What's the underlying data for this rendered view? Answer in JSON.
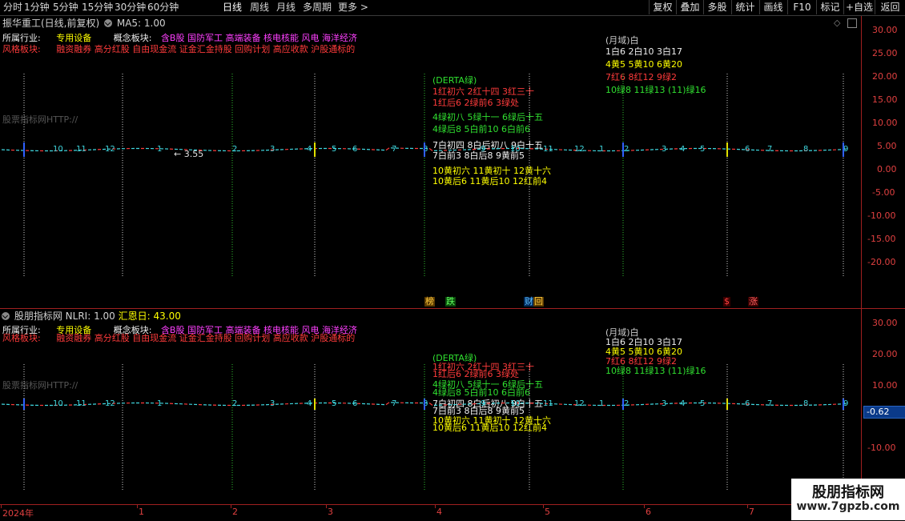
{
  "toolbar": {
    "periods": [
      "分时",
      "1分钟",
      "5分钟",
      "15分钟",
      "30分钟",
      "60分钟",
      "日线",
      "周线",
      "月线",
      "多周期",
      "更多"
    ],
    "active_period": "日线",
    "buttons": [
      "复权",
      "叠加",
      "多股",
      "统计",
      "画线",
      "F10",
      "标记",
      "+自选",
      "返回"
    ]
  },
  "main_pane": {
    "title": "振华重工(日线,前复权)",
    "indicator": "MA5: 1.00",
    "ma_color": "#ffffff",
    "industry_label": "所属行业:",
    "industry_value": "专用设备",
    "concept_label": "概念板块:",
    "concept_value": "含B股 国防军工 高端装备 核电核能 风电 海洋经济",
    "style_label": "风格板块:",
    "style_value": "融资融券 高分红股 自由现金流 证金汇金持股 回购计划 高应收款 沪股通标的",
    "watermark_text": "股票指标网HTTP://",
    "price_marker": "3.55",
    "month_header": "(月域)白",
    "month_row1": "1白6  2白10   3白17",
    "month_row2": "4黄5  5黄10   6黄20",
    "month_row3": "7红6  8红12   9绿2",
    "month_row4": "10绿8  11绿13  (11)绿16",
    "derta_header": "(DERTA绿)",
    "derta_row1": "1红初六   2红十四   3红三十",
    "derta_row2": "1红后6   2绿前6    3绿处",
    "derta_row3": "4绿初八   5绿十一   6绿后十五",
    "derta_row4": "4绿后8   5白前10   6白前6",
    "derta_row5": "7白初四   8白后初八   9白十五",
    "derta_row6": "7白前3   8白后8    9黄前5",
    "derta_row7": "10黄初六  11黄初十  12黄十六",
    "derta_row8": "10黄后6  11黄后10  12红前4",
    "bottom_marks": [
      "榜",
      "跌",
      "财",
      "回",
      "$",
      "涨"
    ],
    "y_ticks": [
      "30.00",
      "25.00",
      "20.00",
      "15.00",
      "10.00",
      "5.00",
      "0.00",
      "-5.00",
      "-10.00",
      "-15.00",
      "-20.00"
    ],
    "x_series_numbers": [
      "10",
      "11",
      "12",
      "1",
      "2",
      "3",
      "4",
      "5",
      "6",
      "7",
      "8",
      "9",
      "10",
      "11",
      "12",
      "1",
      "2",
      "3",
      "4",
      "5",
      "6",
      "7",
      "8",
      "9"
    ]
  },
  "sub_pane": {
    "title": "股朋指标网",
    "indicator": "NLRI: 1.00",
    "indicator2": "汇恩日: 43.00",
    "y_ticks": [
      "30.00",
      "20.00",
      "10.00",
      "-10.00"
    ],
    "current_value": "-0.62"
  },
  "x_axis": {
    "labels": [
      "2024年",
      "1",
      "2",
      "3",
      "4",
      "5",
      "6",
      "7"
    ]
  },
  "watermark": {
    "name": "股朋指标网",
    "url": "www.7gpzb.com"
  },
  "colors": {
    "up": "#ff3b3b",
    "down": "#40d8e0",
    "accent_red": "#a02020",
    "vline_green": "#30c030",
    "vline_white": "#d0d0d0",
    "vline_yellow": "#e0e000"
  }
}
